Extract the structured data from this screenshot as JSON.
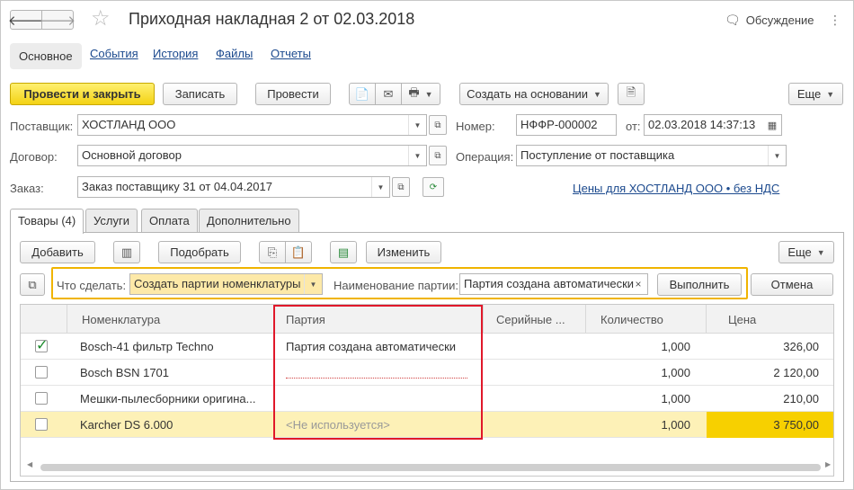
{
  "header": {
    "title": "Приходная накладная 2 от 02.03.2018",
    "discuss_label": "Обсуждение",
    "more_dots": "⋮"
  },
  "section_tabs": [
    "Основное",
    "События",
    "История",
    "Файлы",
    "Отчеты"
  ],
  "toolbar": {
    "post_close": "Провести и закрыть",
    "save": "Записать",
    "post": "Провести",
    "create_based": "Создать на основании",
    "more": "Еще"
  },
  "form": {
    "supplier_label": "Поставщик:",
    "supplier_value": "ХОСТЛАНД ООО",
    "number_label": "Номер:",
    "number_value": "НФФР-000002",
    "date_label": "от:",
    "date_value": "02.03.2018 14:37:13",
    "contract_label": "Договор:",
    "contract_value": "Основной договор",
    "operation_label": "Операция:",
    "operation_value": "Поступление от поставщика",
    "order_label": "Заказ:",
    "order_value": "Заказ поставщику 31 от 04.04.2017",
    "prices_link": "Цены для ХОСТЛАНД ООО • без НДС"
  },
  "inner_tabs": [
    "Товары (4)",
    "Услуги",
    "Оплата",
    "Дополнительно"
  ],
  "goods_toolbar": {
    "add": "Добавить",
    "pick": "Подобрать",
    "change": "Изменить",
    "more": "Еще"
  },
  "action_row": {
    "what_label": "Что сделать:",
    "what_value": "Создать партии номенклатуры",
    "batch_name_label": "Наименование партии:",
    "batch_name_value": "Партия создана автоматически",
    "execute": "Выполнить",
    "cancel": "Отмена"
  },
  "table": {
    "columns": [
      "Номенклатура",
      "Партия",
      "Серийные ...",
      "Количество",
      "Цена"
    ],
    "rows": [
      {
        "checked": true,
        "name": "Bosch-41 фильтр Techno",
        "batch": "Партия создана автоматически",
        "qty": "1,000",
        "price": "326,00"
      },
      {
        "checked": false,
        "name": "Bosch BSN 1701",
        "batch": "",
        "qty": "1,000",
        "price": "2 120,00"
      },
      {
        "checked": false,
        "name": "Мешки-пылесборники оригина...",
        "batch": "",
        "qty": "1,000",
        "price": "210,00"
      },
      {
        "checked": false,
        "name": "Karcher DS 6.000",
        "batch": "<Не используется>",
        "qty": "1,000",
        "price": "3 750,00"
      }
    ]
  },
  "colors": {
    "accent_yellow": "#f3d214",
    "highlight_red": "#e0182a",
    "link_blue": "#1c4a8e",
    "selected_row": "#fdf1b7"
  }
}
